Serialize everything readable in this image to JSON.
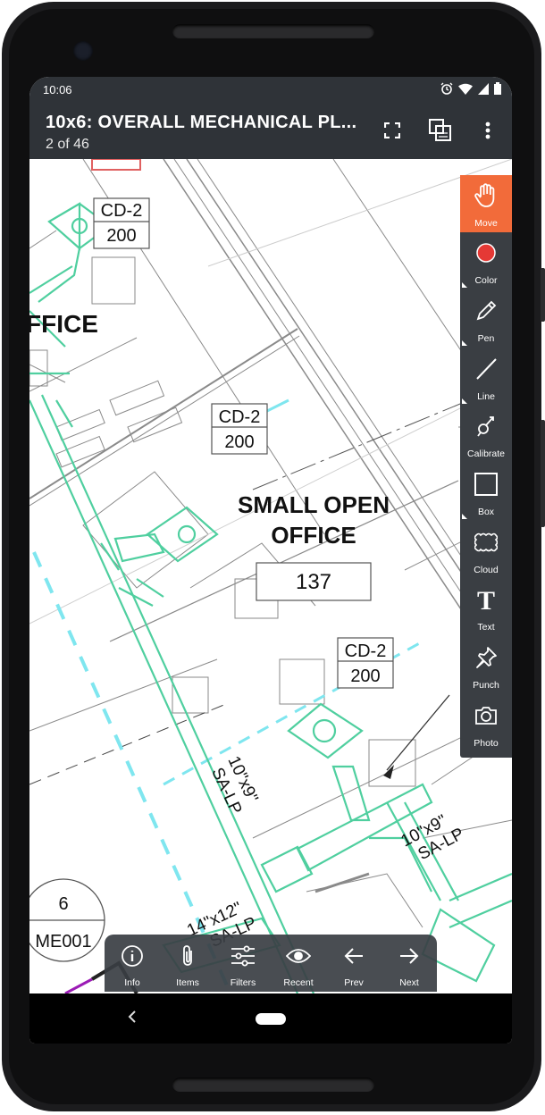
{
  "status": {
    "time": "10:06"
  },
  "appbar": {
    "title": "10x6: OVERALL MECHANICAL PL...",
    "subtitle": "2 of 46"
  },
  "drawing": {
    "labels": {
      "office_partial": "FFICE",
      "room_name_line1": "SMALL OPEN",
      "room_name_line2": "OFFICE",
      "room_number": "137",
      "tag1_top": "CD-2",
      "tag1_bottom": "200",
      "tag2_top": "CD-2",
      "tag2_bottom": "200",
      "tag3_top": "CD-2",
      "tag3_bottom": "200",
      "duct1_line1": "10\"x9\"",
      "duct1_line2": "SA-LP",
      "duct2_line1": "10\"x9\"",
      "duct2_line2": "SA-LP",
      "duct3_line1": "14\"x12\"",
      "duct3_line2": "SA-LP",
      "detail_number": "6",
      "detail_sheet": "ME001"
    },
    "colors": {
      "duct": "#4fcf9f",
      "dashed": "#7fe6ef",
      "linework": "#8a8a8a"
    }
  },
  "tools": [
    {
      "label": "Move",
      "icon": "hand-icon",
      "active": true
    },
    {
      "label": "Color",
      "icon": "color-dot-icon",
      "color": "#e53935"
    },
    {
      "label": "Pen",
      "icon": "pen-icon"
    },
    {
      "label": "Line",
      "icon": "line-icon"
    },
    {
      "label": "Calibrate",
      "icon": "calibrate-icon"
    },
    {
      "label": "Box",
      "icon": "box-icon"
    },
    {
      "label": "Cloud",
      "icon": "cloud-icon"
    },
    {
      "label": "Text",
      "icon": "text-icon"
    },
    {
      "label": "Punch",
      "icon": "pin-icon"
    },
    {
      "label": "Photo",
      "icon": "camera-icon"
    }
  ],
  "bottom": [
    {
      "label": "Info",
      "icon": "info-icon"
    },
    {
      "label": "Items",
      "icon": "paperclip-icon"
    },
    {
      "label": "Filters",
      "icon": "sliders-icon"
    },
    {
      "label": "Recent",
      "icon": "eye-icon"
    },
    {
      "label": "Prev",
      "icon": "arrow-left-icon"
    },
    {
      "label": "Next",
      "icon": "arrow-right-icon"
    }
  ],
  "accent": "#f26b3a"
}
